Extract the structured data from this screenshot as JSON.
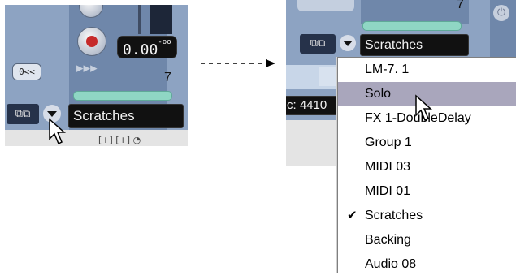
{
  "left": {
    "value_readout": "0.00",
    "value_suffix": "-oo",
    "channel_number": "7",
    "zero_button": "0<<",
    "track_name": "Scratches"
  },
  "right": {
    "channel_number": "7",
    "track_name": "Scratches",
    "partial_value": "c: 4410",
    "menu": {
      "items": [
        {
          "label": "LM-7. 1"
        },
        {
          "label": "Solo"
        },
        {
          "label": "FX 1-DoubleDelay"
        },
        {
          "label": "Group 1"
        },
        {
          "label": "MIDI 03"
        },
        {
          "label": "MIDI 01"
        },
        {
          "label": "Scratches"
        },
        {
          "label": "Backing"
        },
        {
          "label": "Audio 08"
        }
      ],
      "highlighted": "Solo",
      "checked": "Scratches"
    }
  },
  "colors": {
    "panel": "#8da3c2",
    "meter_bar": "#8fd6c4",
    "highlight": "#a9a6bc"
  },
  "icons": [
    "link-icon",
    "dropdown-arrow-icon",
    "mouse-pointer-icon",
    "check-icon",
    "power-icon"
  ]
}
